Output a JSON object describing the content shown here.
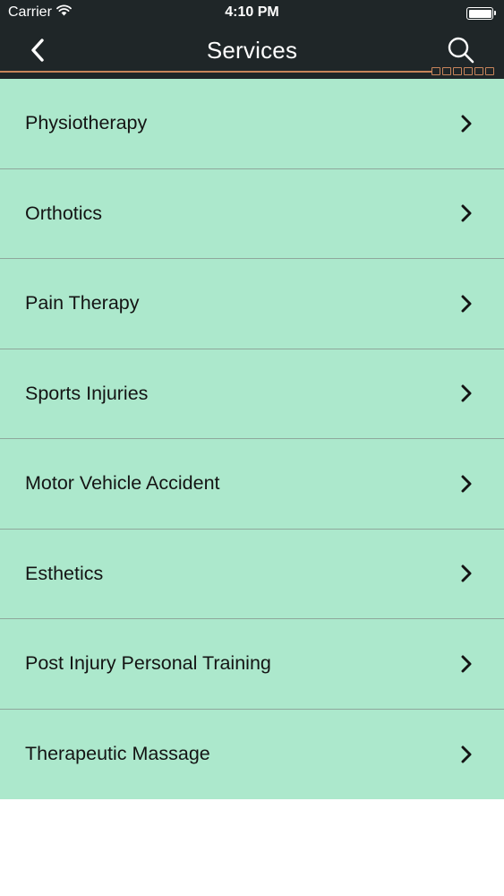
{
  "status_bar": {
    "carrier": "Carrier",
    "time": "4:10 PM",
    "wifi_icon": "wifi-icon",
    "battery_icon": "battery-icon"
  },
  "nav": {
    "title": "Services",
    "back_icon": "chevron-left-icon",
    "search_icon": "search-icon",
    "accent_color": "#c7845a",
    "background_color": "#1f2628"
  },
  "list": {
    "row_color": "#ace8cc",
    "chevron_icon": "chevron-right-icon",
    "items": [
      {
        "label": "Physiotherapy"
      },
      {
        "label": "Orthotics"
      },
      {
        "label": "Pain Therapy"
      },
      {
        "label": "Sports Injuries"
      },
      {
        "label": "Motor Vehicle Accident"
      },
      {
        "label": "Esthetics"
      },
      {
        "label": "Post Injury Personal Training"
      },
      {
        "label": "Therapeutic Massage"
      }
    ]
  }
}
